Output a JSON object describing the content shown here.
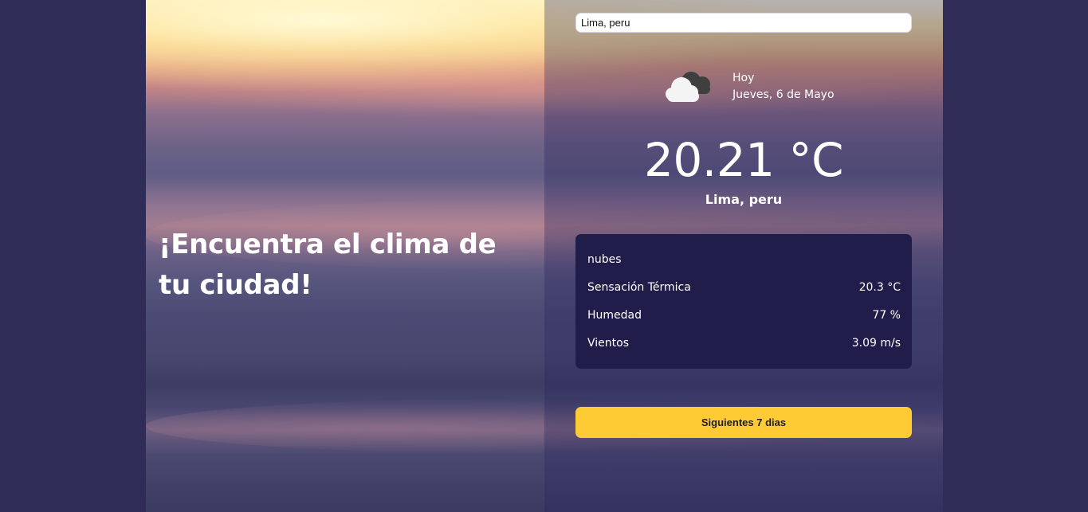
{
  "search": {
    "value": "Lima, peru"
  },
  "hero": {
    "headline": "¡Encuentra el clima de tu ciudad!"
  },
  "current": {
    "icon": "cloud-icon",
    "day_label": "Hoy",
    "date": "Jueves, 6 de Mayo",
    "temperature": "20.21 °C",
    "city": "Lima, peru"
  },
  "details": {
    "description": "nubes",
    "rows": [
      {
        "label": "Sensación Térmica",
        "value": "20.3 °C"
      },
      {
        "label": "Humedad",
        "value": "77 %"
      },
      {
        "label": "Vientos",
        "value": "3.09 m/s"
      }
    ]
  },
  "actions": {
    "next_days_label": "Siguientes 7 dias"
  },
  "colors": {
    "page_background": "#2f2c57",
    "details_card": "#201d4a",
    "button": "#fecb34",
    "text": "#ffffff"
  }
}
